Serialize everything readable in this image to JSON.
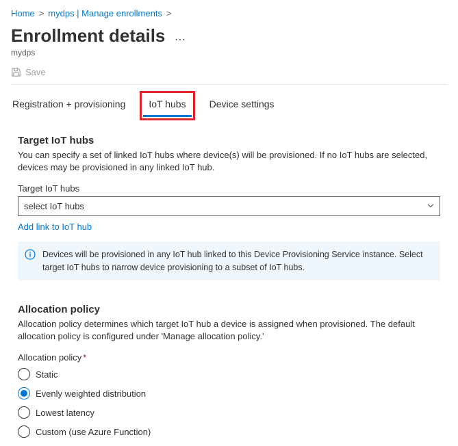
{
  "breadcrumb": {
    "home": "Home",
    "parent": "mydps | Manage enrollments"
  },
  "page": {
    "title": "Enrollment details",
    "subtitle": "mydps"
  },
  "toolbar": {
    "save_label": "Save"
  },
  "tabs": {
    "registration": "Registration + provisioning",
    "iot_hubs": "IoT hubs",
    "device_settings": "Device settings"
  },
  "target_section": {
    "title": "Target IoT hubs",
    "description": "You can specify a set of linked IoT hubs where device(s) will be provisioned. If no IoT hubs are selected, devices may be provisioned in any linked IoT hub.",
    "field_label": "Target IoT hubs",
    "select_placeholder": "select IoT hubs",
    "add_link": "Add link to IoT hub",
    "info_text": "Devices will be provisioned in any IoT hub linked to this Device Provisioning Service instance. Select target IoT hubs to narrow device provisioning to a subset of IoT hubs."
  },
  "allocation_section": {
    "title": "Allocation policy",
    "description": "Allocation policy determines which target IoT hub a device is assigned when provisioned. The default allocation policy is configured under 'Manage allocation policy.'",
    "field_label": "Allocation policy",
    "options": {
      "static": "Static",
      "evenly": "Evenly weighted distribution",
      "lowest": "Lowest latency",
      "custom": "Custom (use Azure Function)"
    },
    "selected": "evenly"
  }
}
